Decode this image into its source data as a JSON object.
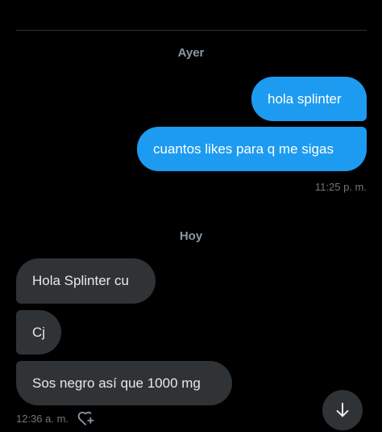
{
  "conversation": {
    "groups": [
      {
        "day": "Ayer",
        "messages": [
          {
            "direction": "sent",
            "text": "hola splinter"
          },
          {
            "direction": "sent",
            "text": "cuantos likes para q me sigas"
          }
        ],
        "timestamp": "11:25 p. m."
      },
      {
        "day": "Hoy",
        "messages": [
          {
            "direction": "received",
            "text": "Hola Splinter cu"
          },
          {
            "direction": "received",
            "text": "Cj"
          },
          {
            "direction": "received",
            "text": "Sos negro así que 1000 mg"
          }
        ],
        "timestamp": "12:36 a. m."
      }
    ]
  },
  "icons": {
    "react": "heart-plus-icon",
    "scroll_down": "arrow-down-icon"
  },
  "colors": {
    "background": "#000000",
    "sent_bubble": "#1d9bf0",
    "received_bubble": "#2f3336",
    "muted_text": "#71767b",
    "day_label": "#8b98a5"
  }
}
